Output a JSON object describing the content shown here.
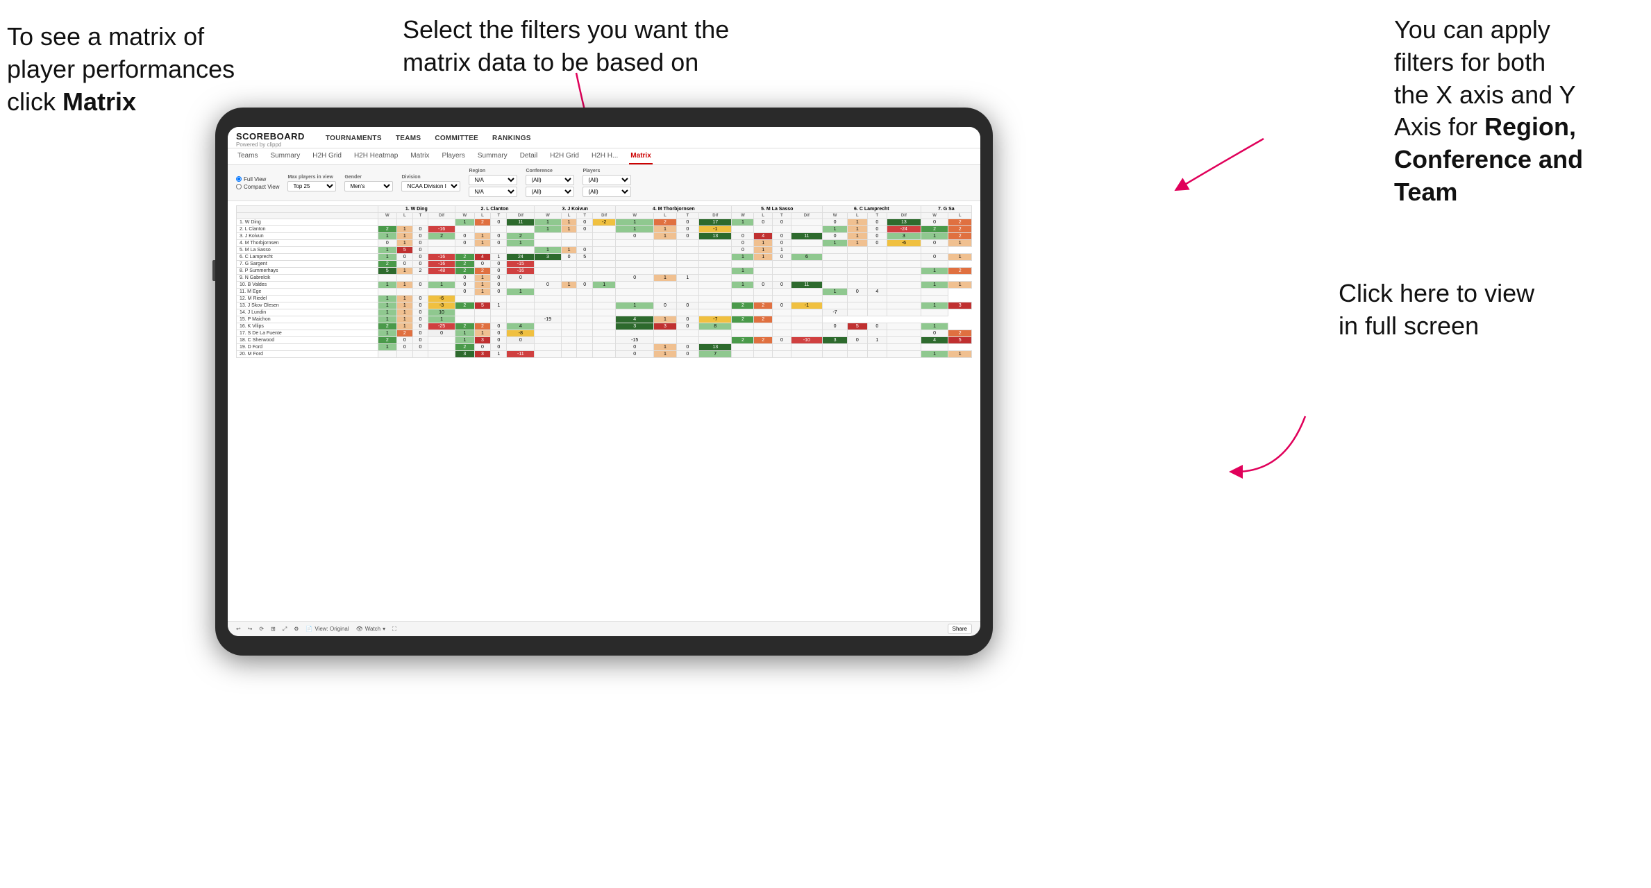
{
  "annotations": {
    "topleft": {
      "line1": "To see a matrix of",
      "line2": "player performances",
      "line3": "click ",
      "line3bold": "Matrix"
    },
    "topmid": {
      "text": "Select the filters you want the matrix data to be based on"
    },
    "topright": {
      "line1": "You  can apply",
      "line2": "filters for both",
      "line3": "the X axis and Y",
      "line4": "Axis for ",
      "line4bold": "Region,",
      "line5bold": "Conference and",
      "line6bold": "Team"
    },
    "bottomright": {
      "line1": "Click here to view",
      "line2": "in full screen"
    }
  },
  "nav": {
    "brand": "SCOREBOARD",
    "brand_sub": "Powered by clippd",
    "links": [
      "TOURNAMENTS",
      "TEAMS",
      "COMMITTEE",
      "RANKINGS"
    ]
  },
  "tabs": {
    "player_tabs": [
      "Teams",
      "Summary",
      "H2H Grid",
      "H2H Heatmap",
      "Matrix",
      "Players",
      "Summary",
      "Detail",
      "H2H Grid",
      "H2H H...",
      "Matrix"
    ],
    "active": "Matrix"
  },
  "filters": {
    "view_options": [
      "Full View",
      "Compact View"
    ],
    "max_players_label": "Max players in view",
    "max_players_value": "Top 25",
    "gender_label": "Gender",
    "gender_value": "Men's",
    "division_label": "Division",
    "division_value": "NCAA Division I",
    "region_label": "Region",
    "region_values": [
      "N/A",
      "N/A"
    ],
    "conference_label": "Conference",
    "conference_values": [
      "(All)",
      "(All)"
    ],
    "players_label": "Players",
    "players_values": [
      "(All)",
      "(All)"
    ]
  },
  "matrix": {
    "col_headers": [
      "1. W Ding",
      "2. L Clanton",
      "3. J Koivun",
      "4. M Thorbjornsen",
      "5. M La Sasso",
      "6. C Lamprecht",
      "7. G Sa"
    ],
    "sub_cols": [
      "W",
      "L",
      "T",
      "Dif"
    ],
    "rows": [
      {
        "name": "1. W Ding",
        "cells": [
          "",
          "",
          "",
          "",
          "1",
          "2",
          "0",
          "11",
          "1",
          "1",
          "0",
          "-2",
          "1",
          "2",
          "0",
          "17",
          "1",
          "0",
          "0",
          "",
          "0",
          "1",
          "0",
          "13",
          "0",
          "2"
        ]
      },
      {
        "name": "2. L Clanton",
        "cells": [
          "2",
          "1",
          "0",
          "-16",
          "",
          "",
          "",
          "",
          "1",
          "1",
          "0",
          "",
          "1",
          "1",
          "0",
          "-1",
          "",
          "",
          "",
          "",
          "1",
          "1",
          "0",
          "-24",
          "2",
          "2"
        ]
      },
      {
        "name": "3. J Koivun",
        "cells": [
          "1",
          "1",
          "0",
          "2",
          "0",
          "1",
          "0",
          "2",
          "",
          "",
          "",
          "",
          "0",
          "1",
          "0",
          "13",
          "0",
          "4",
          "0",
          "11",
          "0",
          "1",
          "0",
          "3",
          "1",
          "2"
        ]
      },
      {
        "name": "4. M Thorbjornsen",
        "cells": [
          "0",
          "1",
          "0",
          "",
          "0",
          "1",
          "0",
          "1",
          "",
          "",
          "",
          "",
          "",
          "",
          "",
          "",
          "0",
          "1",
          "0",
          "",
          "1",
          "1",
          "0",
          "-6",
          "0",
          "1"
        ]
      },
      {
        "name": "5. M La Sasso",
        "cells": [
          "1",
          "5",
          "0",
          "",
          "",
          "",
          "",
          "",
          "1",
          "1",
          "0",
          "",
          "",
          "",
          "",
          "",
          "0",
          "1",
          "1",
          "",
          "",
          "",
          "",
          "",
          ""
        ]
      },
      {
        "name": "6. C Lamprecht",
        "cells": [
          "1",
          "0",
          "0",
          "-16",
          "2",
          "4",
          "1",
          "24",
          "3",
          "0",
          "5",
          "",
          "",
          "",
          "",
          "",
          "1",
          "1",
          "0",
          "6",
          "",
          "",
          "",
          "",
          "0",
          "1"
        ]
      },
      {
        "name": "7. G Sargent",
        "cells": [
          "2",
          "0",
          "0",
          "-16",
          "2",
          "0",
          "0",
          "-15",
          "",
          "",
          "",
          "",
          "",
          "",
          "",
          "",
          "",
          "",
          "",
          "",
          "",
          "",
          "",
          "",
          ""
        ]
      },
      {
        "name": "8. P Summerhays",
        "cells": [
          "5",
          "1",
          "2",
          "-48",
          "2",
          "2",
          "0",
          "-16",
          "",
          "",
          "",
          "",
          "",
          "",
          "",
          "",
          "1",
          "",
          "",
          "",
          "",
          "",
          "",
          "",
          "1",
          "2"
        ]
      },
      {
        "name": "9. N Gabrelcik",
        "cells": [
          "",
          "",
          "",
          "",
          "0",
          "1",
          "0",
          "0",
          "",
          "",
          "",
          "",
          "0",
          "1",
          "1",
          "",
          "",
          "",
          "",
          "",
          "",
          "",
          "",
          "",
          ""
        ]
      },
      {
        "name": "10. B Valdes",
        "cells": [
          "1",
          "1",
          "0",
          "1",
          "0",
          "1",
          "0",
          "",
          "0",
          "1",
          "0",
          "1",
          "",
          "",
          "",
          "",
          "1",
          "0",
          "0",
          "11",
          "",
          "",
          "",
          "",
          "1",
          "1"
        ]
      },
      {
        "name": "11. M Ege",
        "cells": [
          "",
          "",
          "",
          "",
          "0",
          "1",
          "0",
          "1",
          "",
          "",
          "",
          "",
          "",
          "",
          "",
          "",
          "",
          "",
          "",
          "",
          "1",
          "0",
          "4",
          "",
          ""
        ]
      },
      {
        "name": "12. M Riedel",
        "cells": [
          "1",
          "1",
          "0",
          "-6",
          "",
          "",
          "",
          "",
          "",
          "",
          "",
          "",
          "",
          "",
          "",
          "",
          "",
          "",
          "",
          "",
          "",
          "",
          "",
          "",
          ""
        ]
      },
      {
        "name": "13. J Skov Olesen",
        "cells": [
          "1",
          "1",
          "0",
          "-3",
          "2",
          "5",
          "1",
          "",
          "",
          "",
          "",
          "",
          "1",
          "0",
          "0",
          "",
          "2",
          "2",
          "0",
          "-1",
          "",
          "",
          "",
          "",
          "1",
          "3"
        ]
      },
      {
        "name": "14. J Lundin",
        "cells": [
          "1",
          "1",
          "0",
          "10",
          "",
          "",
          "",
          "",
          "",
          "",
          "",
          "",
          "",
          "",
          "",
          "",
          "",
          "",
          "",
          "",
          "-7",
          "",
          "",
          "",
          ""
        ]
      },
      {
        "name": "15. P Maichon",
        "cells": [
          "1",
          "1",
          "0",
          "1",
          "",
          "",
          "",
          "",
          "-19",
          "",
          "",
          "",
          "4",
          "1",
          "0",
          "-7",
          "2",
          "2",
          "",
          ""
        ]
      },
      {
        "name": "16. K Vilips",
        "cells": [
          "2",
          "1",
          "0",
          "-25",
          "2",
          "2",
          "0",
          "4",
          "",
          "",
          "",
          "",
          "3",
          "3",
          "0",
          "8",
          "",
          "",
          "",
          "",
          "0",
          "5",
          "0",
          "",
          "1"
        ]
      },
      {
        "name": "17. S De La Fuente",
        "cells": [
          "1",
          "2",
          "0",
          "0",
          "1",
          "1",
          "0",
          "-8",
          "",
          "",
          "",
          "",
          "",
          "",
          "",
          "",
          "",
          "",
          "",
          "",
          "",
          "",
          "",
          "",
          "0",
          "2"
        ]
      },
      {
        "name": "18. C Sherwood",
        "cells": [
          "2",
          "0",
          "0",
          "",
          "1",
          "3",
          "0",
          "0",
          "",
          "",
          "",
          "",
          "-15",
          "",
          "",
          "",
          "2",
          "2",
          "0",
          "-10",
          "3",
          "0",
          "1",
          "",
          "4",
          "5"
        ]
      },
      {
        "name": "19. D Ford",
        "cells": [
          "1",
          "0",
          "0",
          "",
          "2",
          "0",
          "0",
          "",
          "",
          "",
          "",
          "",
          "0",
          "1",
          "0",
          "13",
          "",
          "",
          "",
          "",
          "",
          "",
          "",
          "",
          ""
        ]
      },
      {
        "name": "20. M Ford",
        "cells": [
          "",
          "",
          "",
          "",
          "3",
          "3",
          "1",
          "-11",
          "",
          "",
          "",
          "",
          "0",
          "1",
          "0",
          "7",
          "",
          "",
          "",
          "",
          "",
          "",
          "",
          "",
          "1",
          "1"
        ]
      }
    ]
  },
  "bottom_bar": {
    "view_label": "View: Original",
    "watch_label": "Watch",
    "share_label": "Share"
  }
}
